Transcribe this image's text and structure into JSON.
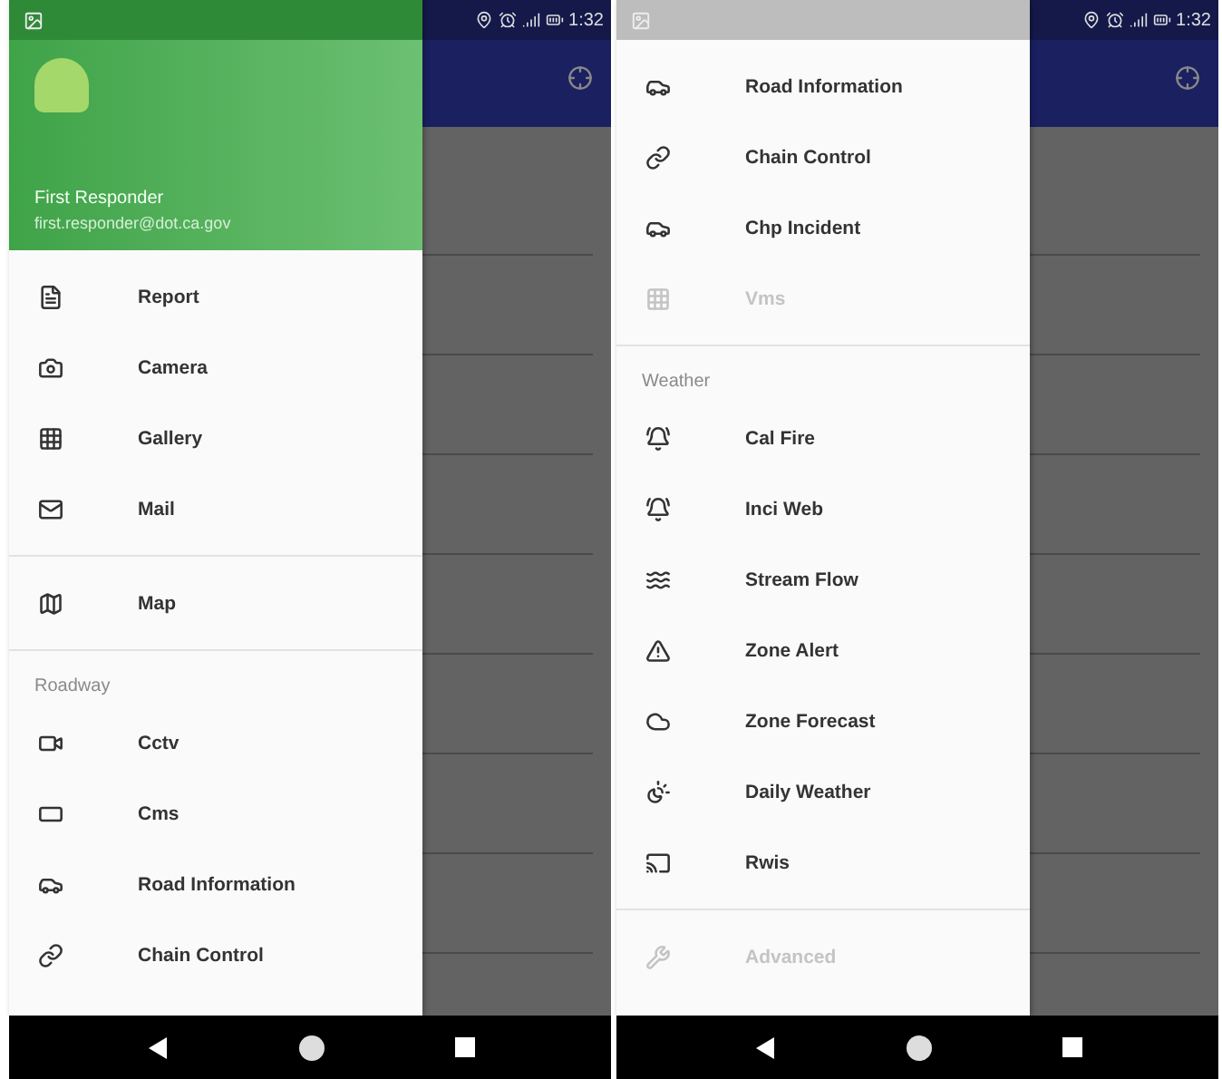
{
  "screens": [
    {
      "status_bar": {
        "time": "1:32"
      },
      "drawer": {
        "header": {
          "name": "First Responder",
          "email": "first.responder@dot.ca.gov"
        },
        "sections": [
          {
            "items": [
              {
                "label": "Report",
                "kind": "report",
                "disabled": false
              },
              {
                "label": "Camera",
                "kind": "camera",
                "disabled": false
              },
              {
                "label": "Gallery",
                "kind": "grid",
                "disabled": false
              },
              {
                "label": "Mail",
                "kind": "mail",
                "disabled": false
              }
            ]
          },
          {
            "items": [
              {
                "label": "Map",
                "kind": "map",
                "disabled": false
              }
            ]
          },
          {
            "title": "Roadway",
            "items": [
              {
                "label": "Cctv",
                "kind": "video",
                "disabled": false
              },
              {
                "label": "Cms",
                "kind": "sign",
                "disabled": false
              },
              {
                "label": "Road Information",
                "kind": "car",
                "disabled": false
              },
              {
                "label": "Chain Control",
                "kind": "link",
                "disabled": false
              }
            ]
          }
        ]
      }
    },
    {
      "status_bar": {
        "time": "1:32"
      },
      "drawer": {
        "sections": [
          {
            "items": [
              {
                "label": "Road Information",
                "kind": "car",
                "disabled": false
              },
              {
                "label": "Chain Control",
                "kind": "link",
                "disabled": false
              },
              {
                "label": "Chp Incident",
                "kind": "car",
                "disabled": false
              },
              {
                "label": "Vms",
                "kind": "grid",
                "disabled": true
              }
            ]
          },
          {
            "title": "Weather",
            "items": [
              {
                "label": "Cal Fire",
                "kind": "bell",
                "disabled": false
              },
              {
                "label": "Inci Web",
                "kind": "bell",
                "disabled": false
              },
              {
                "label": "Stream Flow",
                "kind": "waves",
                "disabled": false
              },
              {
                "label": "Zone Alert",
                "kind": "alert",
                "disabled": false
              },
              {
                "label": "Zone Forecast",
                "kind": "cloud",
                "disabled": false
              },
              {
                "label": "Daily Weather",
                "kind": "sun",
                "disabled": false
              },
              {
                "label": "Rwis",
                "kind": "cast",
                "disabled": false
              }
            ]
          },
          {
            "items": [
              {
                "label": "Advanced",
                "kind": "wrench",
                "disabled": true
              }
            ]
          }
        ]
      }
    }
  ]
}
